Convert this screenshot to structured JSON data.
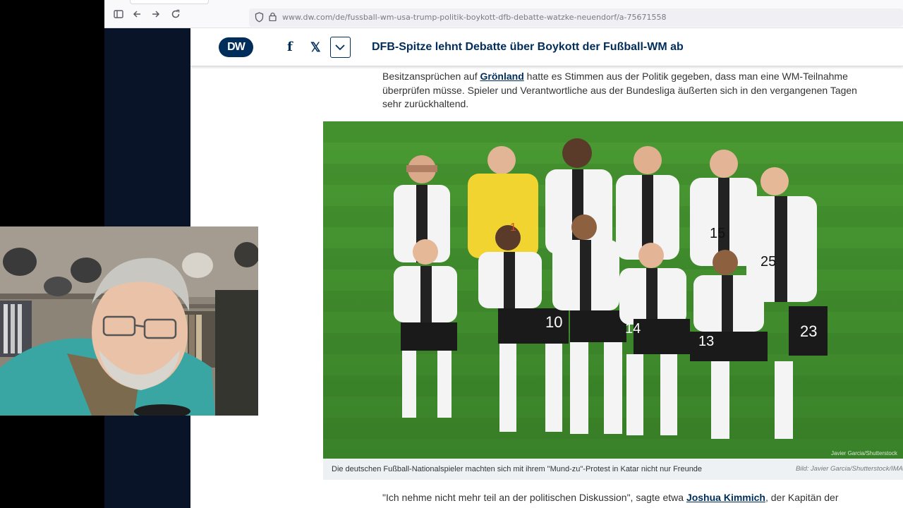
{
  "browser": {
    "url": "www.dw.com/de/fussball-wm-usa-trump-politik-boykott-dfb-debatte-watzke-neuendorf/a-75671558"
  },
  "header": {
    "logo": "DW",
    "share_facebook": "f",
    "share_x": "𝕏",
    "title": "DFB-Spitze lehnt Debatte über Boykott der Fußball-WM ab"
  },
  "article": {
    "p1_pre": "Besitzansprüchen auf ",
    "p1_link": "Grönland",
    "p1_post": " hatte es Stimmen aus der Politik gegeben, dass man eine WM-Teilnahme überprüfen müsse. Spieler und Verantwortliche aus der Bundesliga äußerten sich in den vergangenen Tagen sehr zurückhaltend.",
    "image_caption": "Die deutschen Fußball-Nationalspieler machten sich mit ihrem \"Mund-zu\"-Protest in Katar nicht nur Freunde",
    "image_credit": "Bild: Javier Garcia/Shutterstock/IMA",
    "image_watermark": "Javier Garcia/Shutterstock",
    "p2_pre": "\"Ich nehme nicht mehr teil an der politischen Diskussion\", sagte etwa ",
    "p2_link": "Joshua Kimmich",
    "p2_post": ", der Kapitän der"
  },
  "photo": {
    "jersey_numbers": [
      "1",
      "15",
      "25",
      "10",
      "14",
      "13",
      "23",
      "1"
    ]
  },
  "colors": {
    "dw_blue": "#002d5a",
    "pitch_green": "#3f8e2e",
    "sidebar_navy": "#0a1428"
  }
}
